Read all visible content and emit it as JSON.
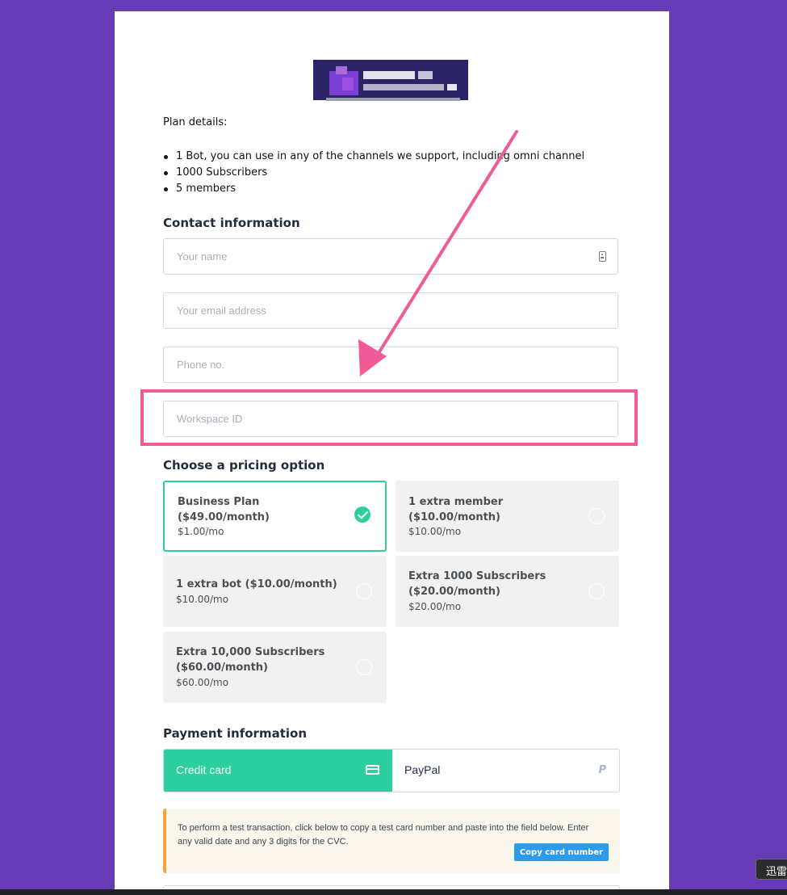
{
  "plan": {
    "label": "Plan details:",
    "items": [
      "1 Bot, you can use in any of the channels we support, including omni channel",
      "1000 Subscribers",
      "5 members"
    ]
  },
  "contact": {
    "title": "Contact information",
    "name_placeholder": "Your name",
    "email_placeholder": "Your email address",
    "phone_placeholder": "Phone no.",
    "workspace_placeholder": "Workspace ID"
  },
  "pricing": {
    "title": "Choose a pricing option",
    "options": [
      {
        "title": "Business Plan ($49.00/month)",
        "price": "$1.00/mo",
        "selected": true
      },
      {
        "title": "1 extra member ($10.00/month)",
        "price": "$10.00/mo",
        "selected": false
      },
      {
        "title": "1 extra bot ($10.00/month)",
        "price": "$10.00/mo",
        "selected": false
      },
      {
        "title": "Extra 1000 Subscribers ($20.00/month)",
        "price": "$20.00/mo",
        "selected": false
      },
      {
        "title": "Extra 10,000 Subscribers ($60.00/month)",
        "price": "$60.00/mo",
        "selected": false
      }
    ]
  },
  "payment": {
    "title": "Payment information",
    "credit_label": "Credit card",
    "paypal_label": "PayPal",
    "active_tab": "Credit card",
    "notice": "To perform a test transaction, click below to copy a test card number and paste into the field below. Enter any valid date and any 3 digits for the CVC.",
    "copy_button": "Copy card number"
  },
  "overlay": {
    "badge_text": "迅雷"
  },
  "colors": {
    "background": "#673ab7",
    "accent": "#2dcf9f",
    "highlight": "#f05a96",
    "notice_border": "#f5a33a",
    "button_blue": "#2e9bea"
  },
  "icons": [
    "contact-card-icon",
    "checkmark-icon",
    "credit-card-icon",
    "paypal-icon"
  ]
}
